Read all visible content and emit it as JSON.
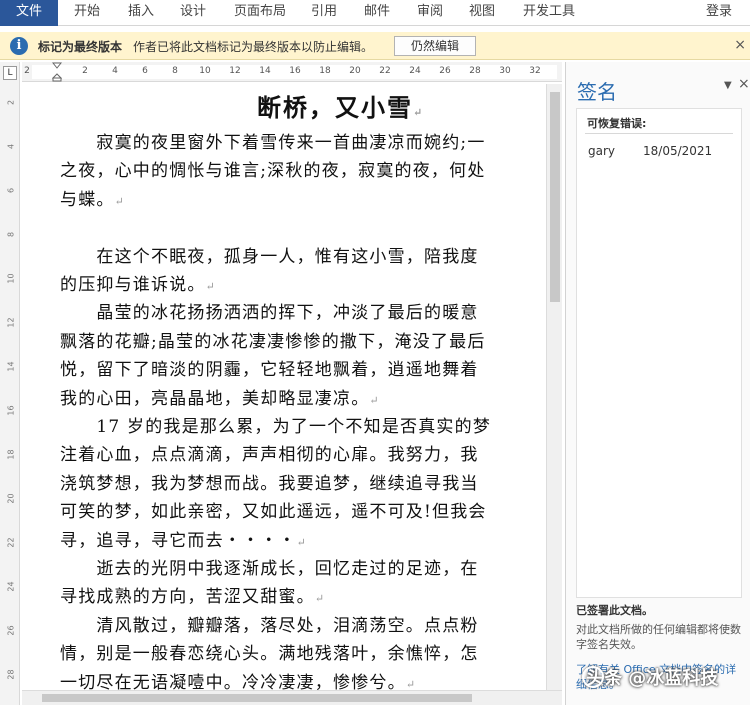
{
  "ribbon": {
    "tabs": [
      "文件",
      "开始",
      "插入",
      "设计",
      "页面布局",
      "引用",
      "邮件",
      "审阅",
      "视图",
      "开发工具"
    ],
    "login": "登录"
  },
  "message_bar": {
    "title": "标记为最终版本",
    "text": "作者已将此文档标记为最终版本以防止编辑。",
    "button": "仍然编辑",
    "close": "×"
  },
  "ruler": {
    "tab_selector": "L",
    "h_ticks": [
      "2",
      "2",
      "4",
      "6",
      "8",
      "10",
      "12",
      "14",
      "16",
      "18",
      "20",
      "22",
      "24",
      "26",
      "28",
      "30",
      "32"
    ],
    "v_ticks": [
      "2",
      "4",
      "6",
      "8",
      "10",
      "12",
      "14",
      "16",
      "18",
      "20",
      "22",
      "24",
      "26",
      "28"
    ]
  },
  "document": {
    "title": "断桥，又小雪",
    "lines": [
      "　　寂寞的夜里窗外下着雪传来一首曲凄凉而婉约;一",
      "之夜，心中的惆怅与谁言;深秋的夜，寂寞的夜，何处",
      "与蝶。",
      "",
      "　　在这个不眠夜，孤身一人，惟有这小雪，陪我度",
      "的压抑与谁诉说。",
      "　　晶莹的冰花扬扬洒洒的挥下，冲淡了最后的暖意",
      "飘落的花瓣;晶莹的冰花凄凄惨惨的撒下，淹没了最后",
      "悦，留下了暗淡的阴霾，它轻轻地飘着，逍遥地舞着",
      "我的心田，亮晶晶地，美却略显凄凉。",
      "　　17 岁的我是那么累，为了一个不知是否真实的梦",
      "注着心血，点点滴滴，声声相彻的心扉。我努力，我",
      "浇筑梦想，我为梦想而战。我要追梦，继续追寻我当",
      "可笑的梦，如此亲密，又如此遥远，遥不可及!但我会",
      "寻，追寻，寻它而去・・・・",
      "　　逝去的光阴中我逐渐成长，回忆走过的足迹，在",
      "寻找成熟的方向，苦涩又甜蜜。",
      "　　清风散过，瓣瓣落，落尽处，泪滴荡空。点点粉",
      "情，别是一般春恋绕心头。满地残落叶，余憔悴，怎",
      "一切尽在无语凝噎中。冷冷凄凄，惨惨兮。"
    ],
    "mark_lines": [
      2,
      5,
      9,
      14,
      16,
      19
    ]
  },
  "signature_pane": {
    "title": "签名",
    "section_label": "可恢复错误:",
    "signer": "gary",
    "date": "18/05/2021",
    "note_title": "已签署此文档。",
    "note_text": "对此文档所做的任何编辑都将使数字签名失效。",
    "link": "了解有关 Office 文档中签名的详细信息。"
  },
  "watermark": {
    "text": "头条 @冰蓝科技"
  },
  "colors": {
    "accent": "#2b579a",
    "message_bar": "#fff4ce",
    "link": "#2b6cb0"
  }
}
